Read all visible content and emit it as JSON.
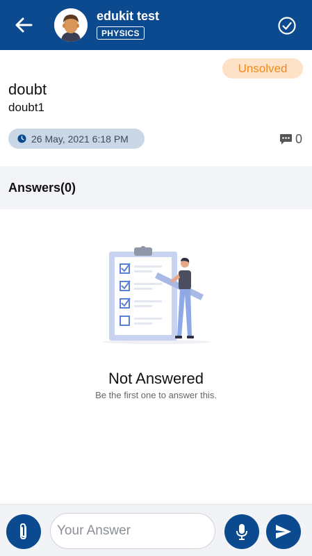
{
  "header": {
    "title": "edukit test",
    "subject": "PHYSICS",
    "icons": {
      "back": "arrow-left-icon",
      "avatar": "user-avatar",
      "resolve": "check-circle-icon"
    }
  },
  "doubt": {
    "status": "Unsolved",
    "title": "doubt",
    "body": "doubt1",
    "date": "26 May, 2021 6:18 PM",
    "comment_count": "0"
  },
  "answers": {
    "heading": "Answers(0)",
    "empty_title": "Not Answered",
    "empty_subtitle": "Be the first one to answer this."
  },
  "composer": {
    "placeholder": "Your Answer",
    "icons": {
      "attach": "paperclip-icon",
      "mic": "microphone-icon",
      "send": "send-icon"
    }
  },
  "colors": {
    "primary": "#0b4a8f",
    "status_bg": "#fde2c8",
    "status_text": "#f08a1c",
    "date_pill_bg": "#c9d7e6",
    "section_bg": "#f2f4f7"
  }
}
